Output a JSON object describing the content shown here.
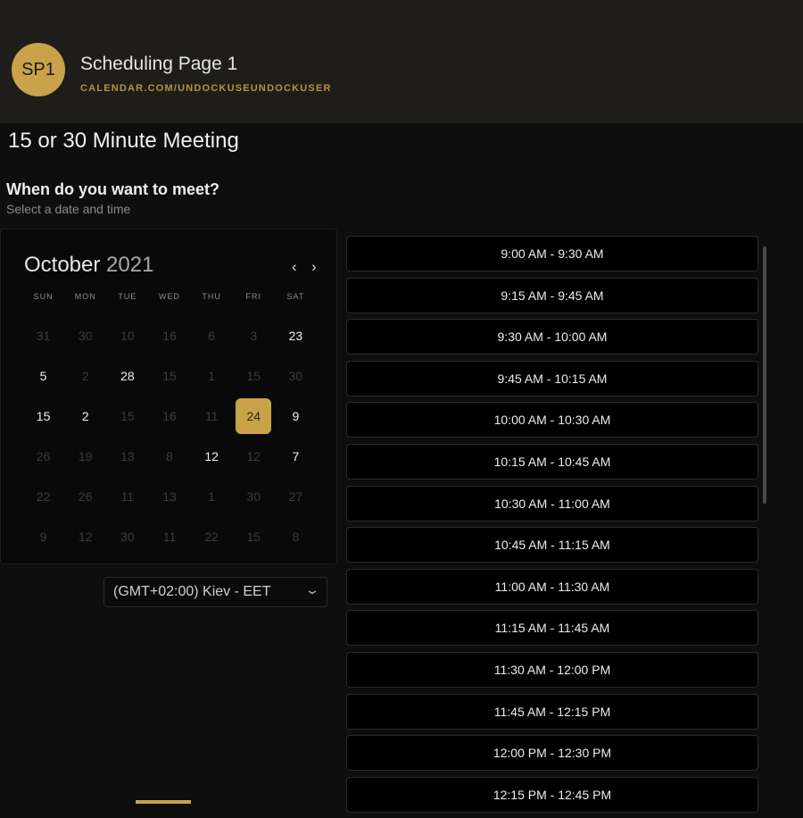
{
  "header": {
    "avatar_text": "SP1",
    "page_name": "Scheduling Page 1",
    "url": "CALENDAR.COM/UNDOCKUSEUNDOCKUSER"
  },
  "meeting_title": "15 or 30 Minute Meeting",
  "question": "When do you want to meet?",
  "subtitle": "Select a date and time",
  "calendar": {
    "month": "October",
    "year": "2021",
    "prev_icon": "‹",
    "next_icon": "›",
    "weekdays": [
      "SUN",
      "MON",
      "TUE",
      "WED",
      "THU",
      "FRI",
      "SAT"
    ],
    "days": [
      {
        "label": "31",
        "available": false
      },
      {
        "label": "30",
        "available": false
      },
      {
        "label": "10",
        "available": false
      },
      {
        "label": "16",
        "available": false
      },
      {
        "label": "6",
        "available": false
      },
      {
        "label": "3",
        "available": false
      },
      {
        "label": "23",
        "available": true
      },
      {
        "label": "5",
        "available": true
      },
      {
        "label": "2",
        "available": false
      },
      {
        "label": "28",
        "available": true
      },
      {
        "label": "15",
        "available": false
      },
      {
        "label": "1",
        "available": false
      },
      {
        "label": "15",
        "available": false
      },
      {
        "label": "30",
        "available": false
      },
      {
        "label": "15",
        "available": true
      },
      {
        "label": "2",
        "available": true
      },
      {
        "label": "15",
        "available": false
      },
      {
        "label": "16",
        "available": false
      },
      {
        "label": "11",
        "available": false
      },
      {
        "label": "24",
        "available": true,
        "selected": true
      },
      {
        "label": "9",
        "available": true
      },
      {
        "label": "26",
        "available": false
      },
      {
        "label": "19",
        "available": false
      },
      {
        "label": "13",
        "available": false
      },
      {
        "label": "8",
        "available": false
      },
      {
        "label": "12",
        "available": true
      },
      {
        "label": "12",
        "available": false
      },
      {
        "label": "7",
        "available": true
      },
      {
        "label": "22",
        "available": false
      },
      {
        "label": "26",
        "available": false
      },
      {
        "label": "11",
        "available": false
      },
      {
        "label": "13",
        "available": false
      },
      {
        "label": "1",
        "available": false
      },
      {
        "label": "30",
        "available": false
      },
      {
        "label": "27",
        "available": false
      },
      {
        "label": "9",
        "available": false
      },
      {
        "label": "12",
        "available": false
      },
      {
        "label": "30",
        "available": false
      },
      {
        "label": "11",
        "available": false
      },
      {
        "label": "22",
        "available": false
      },
      {
        "label": "15",
        "available": false
      },
      {
        "label": "8",
        "available": false
      }
    ]
  },
  "timezone": {
    "value": "(GMT+02:00) Kiev - EET",
    "chevron_icon": "⌄"
  },
  "time_slots": [
    "9:00 AM - 9:30 AM",
    "9:15 AM - 9:45 AM",
    "9:30 AM - 10:00 AM",
    "9:45 AM - 10:15 AM",
    "10:00 AM - 10:30 AM",
    "10:15 AM - 10:45 AM",
    "10:30 AM - 11:00 AM",
    "10:45 AM - 11:15 AM",
    "11:00 AM - 11:30 AM",
    "11:15 AM - 11:45 AM",
    "11:30 AM - 12:00 PM",
    "11:45 AM - 12:15 PM",
    "12:00 PM - 12:30 PM",
    "12:15 PM - 12:45 PM"
  ],
  "colors": {
    "accent": "#c9a24a",
    "header_bg": "#1f1d19",
    "page_bg": "#0e0e0e"
  }
}
